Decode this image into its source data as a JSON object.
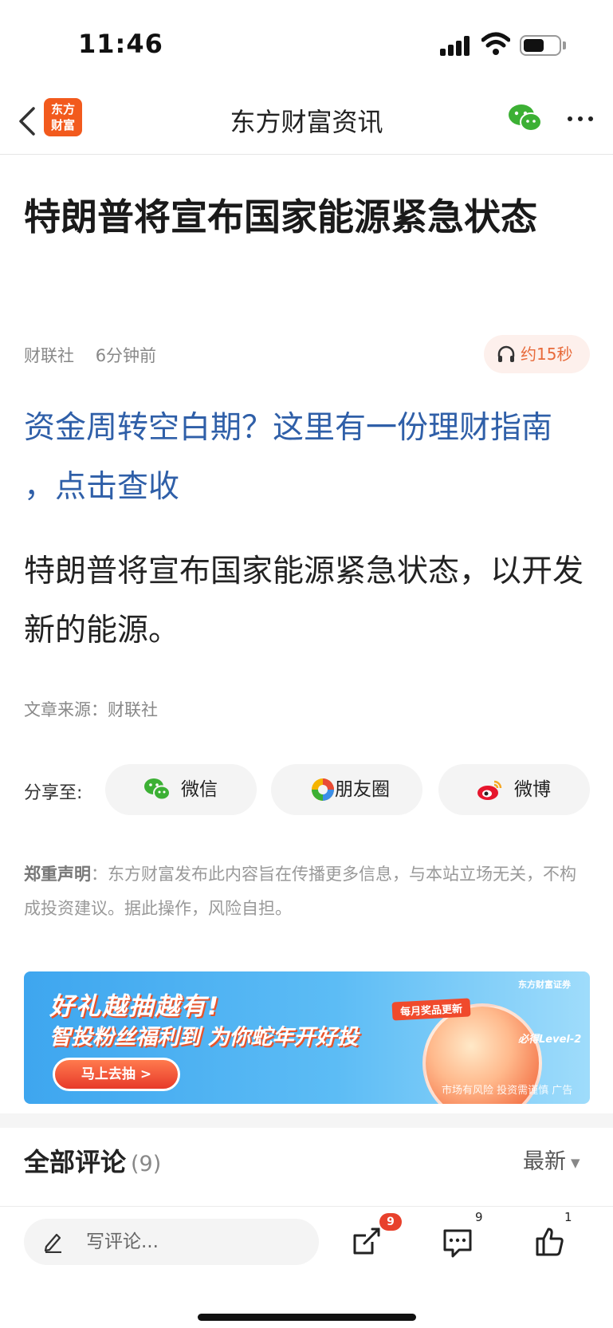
{
  "status_bar": {
    "time": "11:46"
  },
  "nav": {
    "title": "东方财富资讯",
    "logo_text_line1": "东方",
    "logo_text_line2": "财富"
  },
  "article": {
    "title": "特朗普将宣布国家能源紧急状态",
    "source_name": "财联社",
    "time_ago": "6分钟前",
    "audio_label": "约15秒",
    "promo_link": "资金周转空白期？这里有一份理财指南 ，点击查收",
    "body": "特朗普将宣布国家能源紧急状态，以开发新的能源。",
    "source_line": "文章来源：财联社"
  },
  "share": {
    "label": "分享至:",
    "wechat": "微信",
    "moments": "朋友圈",
    "weibo": "微博"
  },
  "disclaimer": {
    "title": "郑重声明",
    "text": "：东方财富发布此内容旨在传播更多信息，与本站立场无关，不构成投资建议。据此操作，风险自担。"
  },
  "banner": {
    "headline": "好礼越抽越有!",
    "subline": "智投粉丝福利到 为你蛇年开好投",
    "cta": "马上去抽 >",
    "badge": "每月奖品更新",
    "level": "必得Level-2",
    "brand": "东方财富证券",
    "risk": "市场有风险 投资需谨慎 广告"
  },
  "comments": {
    "title": "全部评论",
    "count": "(9)",
    "sort": "最新"
  },
  "bottom_bar": {
    "placeholder": "写评论...",
    "share_badge": "9",
    "comment_count": "9",
    "like_count": "1"
  },
  "colors": {
    "accent_orange": "#f25a1d",
    "link_blue": "#2f5fa8",
    "badge_red": "#e8412c",
    "wechat_green": "#3cb034"
  }
}
